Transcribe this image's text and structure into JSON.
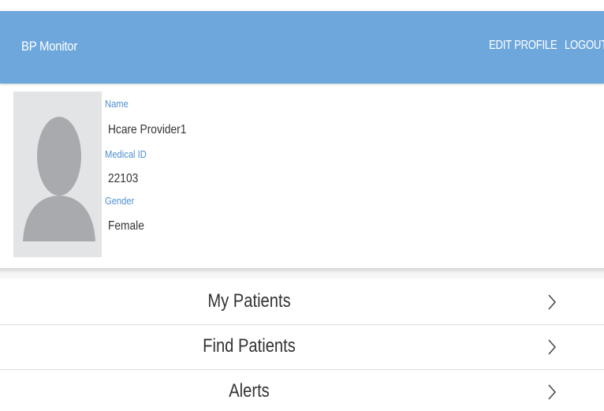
{
  "appbar": {
    "title": "BP Monitor",
    "edit_profile_label": "EDIT PROFILE",
    "logout_label": "LOGOUT",
    "background_color": "#6ea7dc"
  },
  "profile": {
    "avatar_icon": "person-placeholder-icon",
    "fields": {
      "name_label": "Name",
      "name_value": "Hcare Provider1",
      "medical_id_label": "Medical ID",
      "medical_id_value": "22103",
      "gender_label": "Gender",
      "gender_value": "Female"
    },
    "label_color": "#4f8fd0"
  },
  "menu": {
    "items": [
      {
        "label": "My Patients",
        "icon": "chevron-right-icon"
      },
      {
        "label": "Find Patients",
        "icon": "chevron-right-icon"
      },
      {
        "label": "Alerts",
        "icon": "chevron-right-icon"
      }
    ]
  }
}
